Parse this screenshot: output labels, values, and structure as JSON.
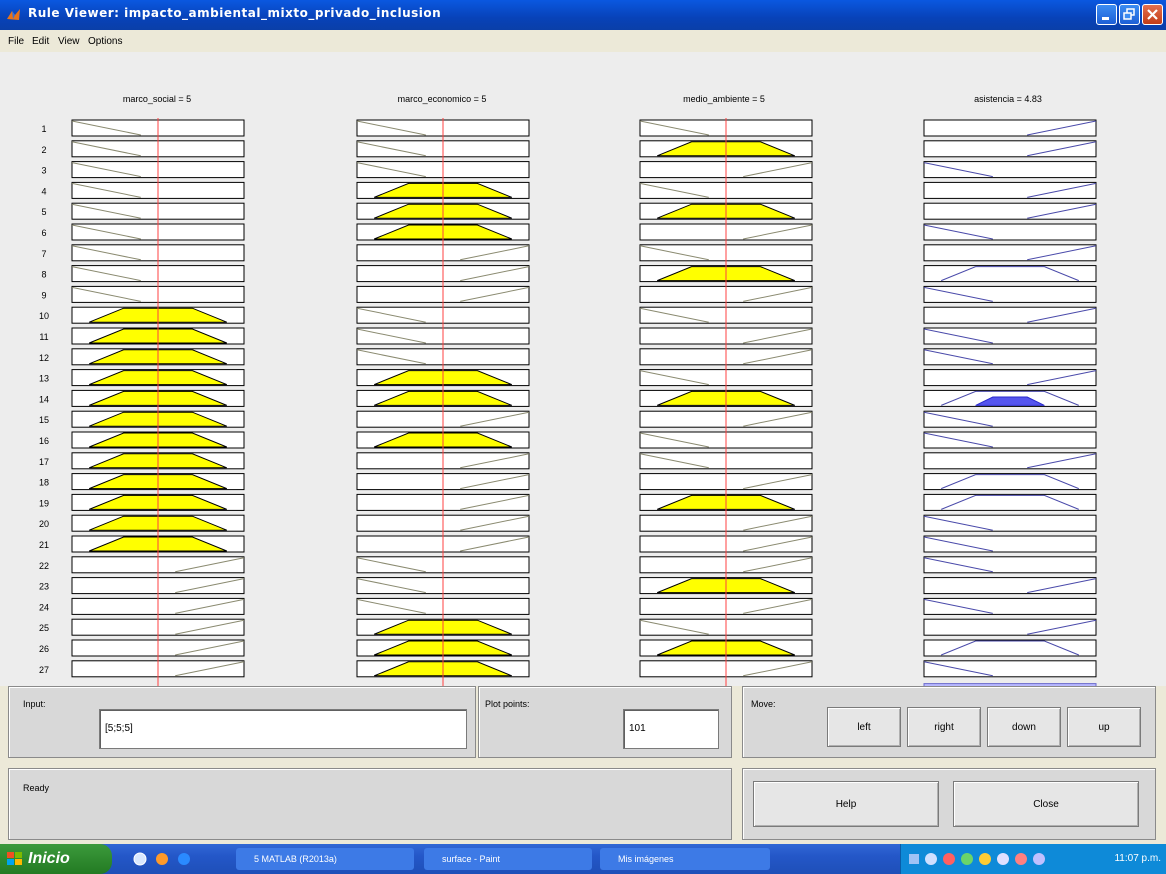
{
  "window": {
    "title": "Rule Viewer: impacto_ambiental_mixto_privado_inclusion"
  },
  "menu": [
    "File",
    "Edit",
    "View",
    "Options"
  ],
  "variables": [
    {
      "label": "marco_social = 5"
    },
    {
      "label": "marco_economico = 5"
    },
    {
      "label": "medio_ambiente = 5"
    },
    {
      "label": "asistencia = 4.83"
    }
  ],
  "rule_numbers": [
    "1",
    "2",
    "3",
    "4",
    "5",
    "6",
    "7",
    "8",
    "9",
    "10",
    "11",
    "12",
    "13",
    "14",
    "15",
    "16",
    "17",
    "18",
    "19",
    "20",
    "21",
    "22",
    "23",
    "24",
    "25",
    "26",
    "27"
  ],
  "rules": {
    "social": [
      "l",
      "l",
      "l",
      "l",
      "l",
      "l",
      "l",
      "l",
      "l",
      "m",
      "m",
      "m",
      "m",
      "m",
      "m",
      "m",
      "m",
      "m",
      "m",
      "m",
      "m",
      "h",
      "h",
      "h",
      "h",
      "h",
      "h"
    ],
    "economico": [
      "l",
      "l",
      "l",
      "m",
      "m",
      "m",
      "h",
      "h",
      "h",
      "l",
      "l",
      "l",
      "m",
      "m",
      "h",
      "m",
      "h",
      "h",
      "h",
      "h",
      "h",
      "l",
      "l",
      "l",
      "m",
      "m",
      "m"
    ],
    "ambiente": [
      "l",
      "m",
      "h",
      "l",
      "m",
      "h",
      "l",
      "m",
      "h",
      "l",
      "h",
      "h",
      "l",
      "m",
      "h",
      "l",
      "l",
      "h",
      "m",
      "h",
      "h",
      "h",
      "m",
      "h",
      "l",
      "m",
      "h"
    ],
    "asistencia": [
      "h",
      "h",
      "l",
      "h",
      "h",
      "l",
      "h",
      "m",
      "l",
      "h",
      "l",
      "l",
      "h",
      "m",
      "l",
      "l",
      "h",
      "m",
      "m",
      "l",
      "l",
      "l",
      "h",
      "l",
      "h",
      "m",
      "l"
    ],
    "fired_output": 14
  },
  "input_value": 5,
  "output_value": 4.83,
  "controls": {
    "input_label": "Input:",
    "input_value": "[5;5;5]",
    "plot_points_label": "Plot points:",
    "plot_points_value": "101",
    "move_label": "Move:",
    "left": "left",
    "right": "right",
    "down": "down",
    "up": "up",
    "status": "Ready",
    "help": "Help",
    "close": "Close"
  },
  "taskbar": {
    "start": "Inicio",
    "tasks": [
      "5 MATLAB (R2013a)",
      "surface - Paint",
      "Mis imágenes"
    ],
    "clock": "11:07 p.m."
  },
  "colors": {
    "fired_input": "#ffff00",
    "fired_output": "#5555ee",
    "marker": "#ff4040"
  }
}
